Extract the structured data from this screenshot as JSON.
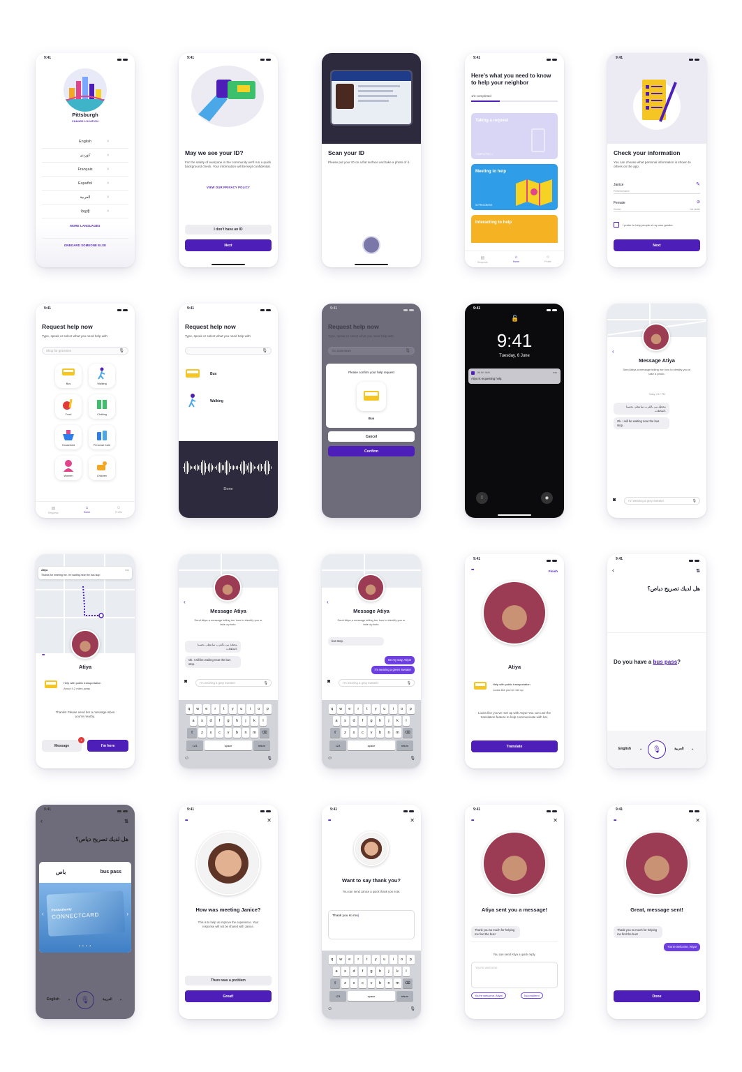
{
  "status": {
    "time": "9:41"
  },
  "s1": {
    "city": "Pittsburgh",
    "change": "CHANGE LOCATION",
    "langs": [
      "English",
      "كوردی",
      "Français",
      "Español",
      "العربية",
      "नेपाली"
    ],
    "more": "MORE LANGUAGES",
    "onboard": "ONBOARD SOMEONE ELSE"
  },
  "s2": {
    "title": "May we see your ID?",
    "body": "For the safety of everyone in the community we'll run a quick background check. Your information will be kept confidential.",
    "privacy": "VIEW OUR PRIVACY POLICY",
    "noid": "I don't have an ID",
    "next": "Next"
  },
  "s3": {
    "title": "Scan your ID",
    "body": "Please put your ID on a flat surface and take a photo of it."
  },
  "s4": {
    "title": "Here's what you need to know to help your neighbor",
    "progress": "1/3 completed",
    "progress_value": 0.33,
    "cards": [
      {
        "label": "Taking a request",
        "status": "COMPLETED ✓"
      },
      {
        "label": "Meeting to help",
        "status": "IN PROGRESS"
      },
      {
        "label": "Interacting to help",
        "status": ""
      }
    ]
  },
  "tabs": {
    "t1": "Requests",
    "t2": "Home",
    "t3": "Profile"
  },
  "s5": {
    "title": "Check your information",
    "body": "You can choose what personal information is shown to others on the app.",
    "name": "Janice",
    "name_label": "Preferred Name",
    "gender": "Female",
    "gender_label": "Gender",
    "visible": "Not visible",
    "checkbox": "I prefer to help people of my own gender.",
    "next": "Next"
  },
  "s6": {
    "title": "Request help now",
    "sub": "Type, speak or select what you need help with",
    "placeholder": "Shop for groceries",
    "cats": [
      "Bus",
      "Walking",
      "Food",
      "Clothing",
      "Household",
      "Personal Care",
      "Women",
      "Children"
    ]
  },
  "s7": {
    "title": "Request help now",
    "sub": "Type, speak or select what you need help with",
    "opts": [
      "Bus",
      "Walking"
    ],
    "done": "Done"
  },
  "s8": {
    "title": "Request help now",
    "sub": "Type, speak or select what you need help with",
    "input": "Go downtown",
    "confirm_text": "Please confirm your help request",
    "choice": "Bus",
    "cancel": "Cancel",
    "confirm": "Confirm"
  },
  "s9": {
    "time": "9:41",
    "date": "Tuesday, 6 June",
    "app": "ON MY WAY",
    "notif_time": "now",
    "notif": "Atiya is requesting help."
  },
  "s10": {
    "title": "Message Atiya",
    "sub": "Send Atiya a message telling her how to identify you or take a photo.",
    "stamp": "Today, 2:17 PM",
    "m1": "محطة من بالقرب سانتظر. بحسنا الحافلات.",
    "m2": "Ok. I will be waiting near the bus stop.",
    "placeholder": "I'm wearing a gray sweater"
  },
  "s11": {
    "notif_name": "Atiya",
    "notif_time": "now",
    "notif": "Thanks for meeting me. I'm waiting near the bus stop",
    "name": "Atiya",
    "task": "Help with public transportation",
    "dist": "About 0.2 miles away",
    "msg": "Thanks! Please send her a message when you're nearby.",
    "message": "Message",
    "badge": "1",
    "here": "I'm here"
  },
  "s12": {
    "title": "Message Atiya",
    "sub": "Send Atiya a message telling her how to identify you or take a photo.",
    "m1": "محطة من بالقرب سانتظر. بحسنا الحافلات.",
    "m2": "Ok. I will be waiting near the bus stop.",
    "placeholder": "I'm wearing a gray sweater"
  },
  "s13": {
    "title": "Message Atiya",
    "sub": "Send Atiya a message telling her how to identify you or take a photo.",
    "m0": "bus stop.",
    "r1": "On my way, Atiya!",
    "r2": "I'm wearing a green sweater",
    "placeholder": "I'm wearing a gray sweater"
  },
  "kb": {
    "row1": [
      "q",
      "w",
      "e",
      "r",
      "t",
      "y",
      "u",
      "i",
      "o",
      "p"
    ],
    "row2": [
      "a",
      "s",
      "d",
      "f",
      "g",
      "h",
      "j",
      "k",
      "l"
    ],
    "row3": [
      "z",
      "x",
      "c",
      "v",
      "b",
      "n",
      "m"
    ],
    "num": "123",
    "space": "space",
    "ret": "return"
  },
  "s14": {
    "finish": "Finish",
    "name": "Atiya",
    "task": "Help with public transportation",
    "looks": "Looks like you've met up",
    "msg": "Looks like you've met up with Atiya! You can use the translation feature to help communicate with her.",
    "translate": "Translate"
  },
  "s15": {
    "arabic": "هل لديك تصريح دياص؟",
    "q_pre": "Do you have a ",
    "q_link": "bus pass",
    "q_post": "?",
    "l1": "English",
    "l2": "العربية"
  },
  "s16": {
    "arabic": "هل لديك تصريح دياص؟",
    "ar_word": "باص",
    "en_word": "bus pass",
    "card1": "PortAuthority",
    "card2": "CONNECTCARD",
    "l1": "English",
    "l2": "العربية"
  },
  "s17": {
    "title": "How was meeting Janice?",
    "sub": "This is to help us improve the experience. Your response will not be shared with Janice.",
    "problem": "There was a problem",
    "great": "Great!"
  },
  "s18": {
    "title": "Want to say thank you?",
    "sub": "You can send Janice a quick thank you note.",
    "input": "Thank you so mu"
  },
  "s19": {
    "title": "Atiya sent you a message!",
    "m1": "Thank you so much for helping me find the bus!",
    "reply": "You can send Atiya a quick reply.",
    "placeholder": "You're welcome",
    "p1": "You're welcome, Atiya!",
    "p2": "No problem!"
  },
  "s20": {
    "title": "Great, message sent!",
    "m1": "Thank you so much for helping me find the bus!",
    "r1": "You're welcome, Atiya!",
    "done": "Done"
  },
  "colors": {
    "primary": "#4e1fb8",
    "accent": "#6e3fe0"
  }
}
